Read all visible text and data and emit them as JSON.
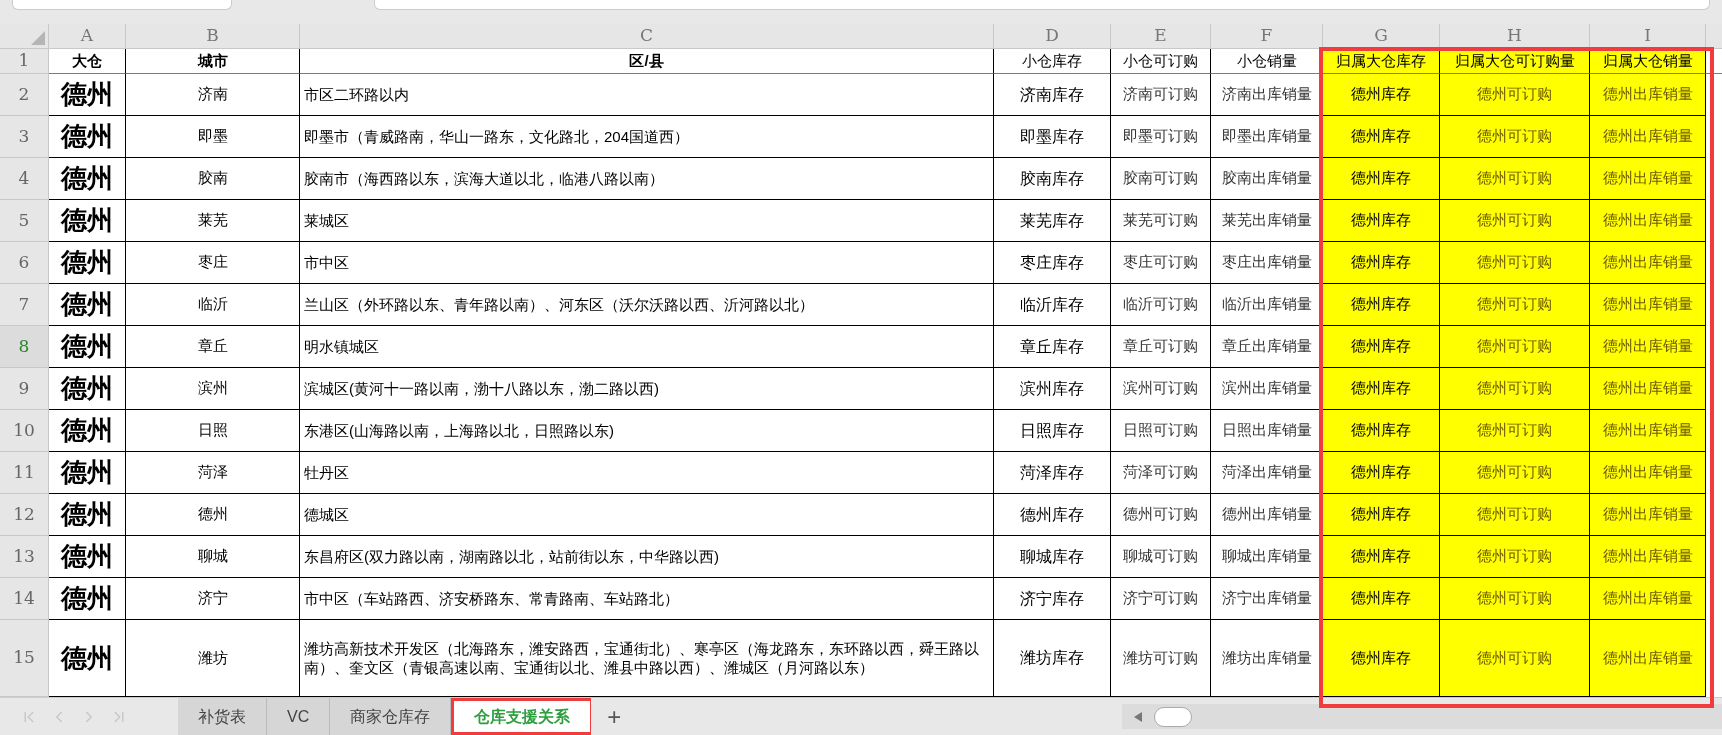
{
  "columns": [
    {
      "letter": "A",
      "highlighted": false
    },
    {
      "letter": "B",
      "highlighted": false
    },
    {
      "letter": "C",
      "highlighted": false
    },
    {
      "letter": "D",
      "highlighted": false
    },
    {
      "letter": "E",
      "highlighted": false
    },
    {
      "letter": "F",
      "highlighted": false
    },
    {
      "letter": "G",
      "highlighted": true
    },
    {
      "letter": "H",
      "highlighted": true
    },
    {
      "letter": "I",
      "highlighted": true
    }
  ],
  "rows": [
    {
      "number": "1",
      "selected": false,
      "cells": [
        "大仓",
        "城市",
        "区/县",
        "小仓库存",
        "小仓可订购",
        "小仓销量",
        "归属大仓库存",
        "归属大仓可订购量",
        "归属大仓销量"
      ]
    },
    {
      "number": "2",
      "selected": false,
      "cells": [
        "德州",
        "济南",
        "市区二环路以内",
        "济南库存",
        "济南可订购",
        "济南出库销量",
        "德州库存",
        "德州可订购",
        "德州出库销量"
      ]
    },
    {
      "number": "3",
      "selected": false,
      "cells": [
        "德州",
        "即墨",
        "即墨市（青威路南，华山一路东，文化路北，204国道西）",
        "即墨库存",
        "即墨可订购",
        "即墨出库销量",
        "德州库存",
        "德州可订购",
        "德州出库销量"
      ]
    },
    {
      "number": "4",
      "selected": false,
      "cells": [
        "德州",
        "胶南",
        "胶南市（海西路以东，滨海大道以北，临港八路以南）",
        "胶南库存",
        "胶南可订购",
        "胶南出库销量",
        "德州库存",
        "德州可订购",
        "德州出库销量"
      ]
    },
    {
      "number": "5",
      "selected": false,
      "cells": [
        "德州",
        "莱芜",
        "莱城区",
        "莱芜库存",
        "莱芜可订购",
        "莱芜出库销量",
        "德州库存",
        "德州可订购",
        "德州出库销量"
      ]
    },
    {
      "number": "6",
      "selected": false,
      "cells": [
        "德州",
        "枣庄",
        "市中区",
        "枣庄库存",
        "枣庄可订购",
        "枣庄出库销量",
        "德州库存",
        "德州可订购",
        "德州出库销量"
      ]
    },
    {
      "number": "7",
      "selected": false,
      "cells": [
        "德州",
        "临沂",
        "兰山区（外环路以东、青年路以南）、河东区（沃尔沃路以西、沂河路以北）",
        "临沂库存",
        "临沂可订购",
        "临沂出库销量",
        "德州库存",
        "德州可订购",
        "德州出库销量"
      ]
    },
    {
      "number": "8",
      "selected": true,
      "cells": [
        "德州",
        "章丘",
        "明水镇城区",
        "章丘库存",
        "章丘可订购",
        "章丘出库销量",
        "德州库存",
        "德州可订购",
        "德州出库销量"
      ]
    },
    {
      "number": "9",
      "selected": false,
      "cells": [
        "德州",
        "滨州",
        "滨城区(黄河十一路以南，渤十八路以东，渤二路以西)",
        "滨州库存",
        "滨州可订购",
        "滨州出库销量",
        "德州库存",
        "德州可订购",
        "德州出库销量"
      ]
    },
    {
      "number": "10",
      "selected": false,
      "cells": [
        "德州",
        "日照",
        "东港区(山海路以南，上海路以北，日照路以东)",
        "日照库存",
        "日照可订购",
        "日照出库销量",
        "德州库存",
        "德州可订购",
        "德州出库销量"
      ]
    },
    {
      "number": "11",
      "selected": false,
      "cells": [
        "德州",
        "菏泽",
        "牡丹区",
        "菏泽库存",
        "菏泽可订购",
        "菏泽出库销量",
        "德州库存",
        "德州可订购",
        "德州出库销量"
      ]
    },
    {
      "number": "12",
      "selected": false,
      "cells": [
        "德州",
        "德州",
        "德城区",
        "德州库存",
        "德州可订购",
        "德州出库销量",
        "德州库存",
        "德州可订购",
        "德州出库销量"
      ]
    },
    {
      "number": "13",
      "selected": false,
      "cells": [
        "德州",
        "聊城",
        "东昌府区(双力路以南，湖南路以北，站前街以东，中华路以西)",
        "聊城库存",
        "聊城可订购",
        "聊城出库销量",
        "德州库存",
        "德州可订购",
        "德州出库销量"
      ]
    },
    {
      "number": "14",
      "selected": false,
      "cells": [
        "德州",
        "济宁",
        "市中区（车站路西、济安桥路东、常青路南、车站路北）",
        "济宁库存",
        "济宁可订购",
        "济宁出库销量",
        "德州库存",
        "德州可订购",
        "德州出库销量"
      ]
    },
    {
      "number": "15",
      "selected": false,
      "cells": [
        "德州",
        "潍坊",
        "潍坊高新技术开发区（北海路东，潍安路西，宝通街北）、寒亭区（海龙路东，东环路以西，舜王路以南）、奎文区（青银高速以南、宝通街以北、潍县中路以西）、潍城区（月河路以东）",
        "潍坊库存",
        "潍坊可订购",
        "潍坊出库销量",
        "德州库存",
        "德州可订购",
        "德州出库销量"
      ]
    }
  ],
  "sheet_tabs": [
    {
      "label": "补货表",
      "selected": false,
      "highlighted": false
    },
    {
      "label": "VC",
      "selected": false,
      "highlighted": false
    },
    {
      "label": "商家仓库存",
      "selected": false,
      "highlighted": false
    },
    {
      "label": "仓库支援关系",
      "selected": true,
      "highlighted": true
    }
  ],
  "add_sheet": "+"
}
